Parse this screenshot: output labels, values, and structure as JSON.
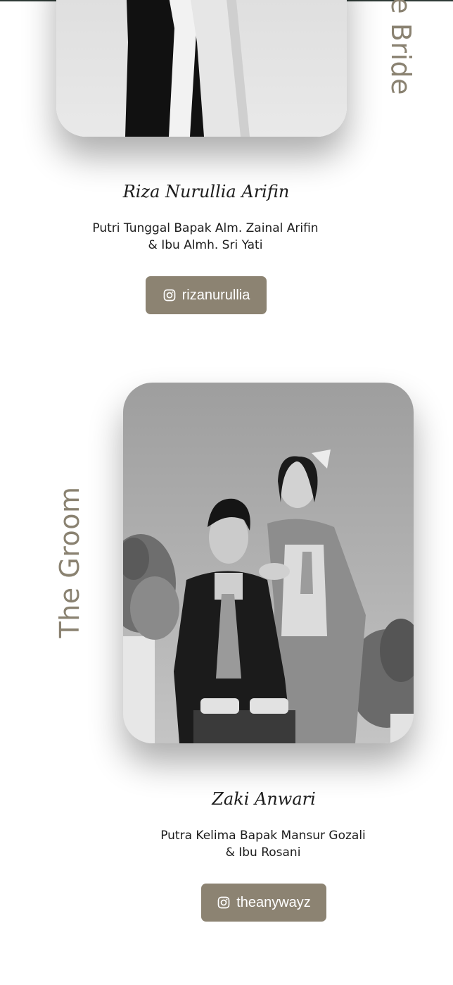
{
  "bride": {
    "side_label": "The Bride",
    "name": "Riza Nurullia Arifin",
    "desc_line1": "Putri Tunggal Bapak Alm. Zainal Arifin",
    "desc_line2": "& Ibu Almh. Sri Yati",
    "instagram": "rizanurullia"
  },
  "groom": {
    "side_label": "The Groom",
    "name": "Zaki Anwari",
    "desc_line1": "Putra Kelima Bapak Mansur Gozali",
    "desc_line2": "& Ibu Rosani",
    "instagram": "theanywayz"
  },
  "colors": {
    "accent": "#8c8372",
    "label": "#8a8271",
    "text": "#1c1c1c"
  },
  "icons": {
    "instagram": "instagram-icon"
  }
}
